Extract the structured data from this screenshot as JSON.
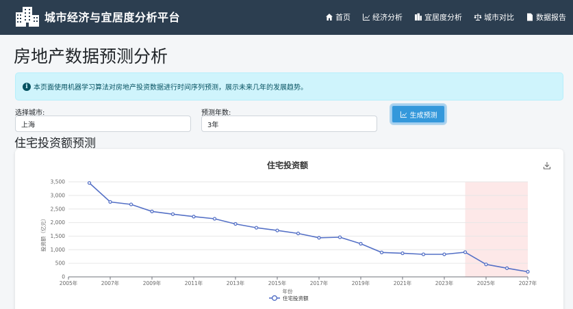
{
  "navbar": {
    "brand": "城市经济与宜居度分析平台",
    "items": [
      {
        "label": "首页",
        "icon": "home-icon"
      },
      {
        "label": "经济分析",
        "icon": "chart-line-icon"
      },
      {
        "label": "宜居度分析",
        "icon": "building-icon"
      },
      {
        "label": "城市对比",
        "icon": "balance-scale-icon"
      },
      {
        "label": "数据报告",
        "icon": "file-icon"
      }
    ]
  },
  "page": {
    "title": "房地产数据预测分析",
    "info": "本页面使用机器学习算法对房地产投资数据进行时间序列预测，展示未来几年的发展趋势。"
  },
  "form": {
    "city_label": "选择城市:",
    "city_value": "上海",
    "years_label": "预测年数:",
    "years_value": "3年",
    "button_label": "生成预测"
  },
  "section_title": "住宅投资额预测",
  "chart_data": {
    "type": "line",
    "title": "住宅投资额",
    "xlabel": "年份",
    "ylabel": "投资额（亿元）",
    "x_tick_labels": [
      "2005年",
      "2007年",
      "2009年",
      "2011年",
      "2013年",
      "2015年",
      "2017年",
      "2019年",
      "2021年",
      "2023年",
      "2025年",
      "2027年"
    ],
    "y_tick_labels": [
      "0",
      "500",
      "1,000",
      "1,500",
      "2,000",
      "2,500",
      "3,000",
      "3,500"
    ],
    "ylim": [
      0,
      3500
    ],
    "xlim": [
      2005,
      2027
    ],
    "forecast_range": [
      2024,
      2027
    ],
    "legend_position": "bottom-center",
    "series": [
      {
        "name": "住宅投资额",
        "color": "#5470c6",
        "x": [
          2006,
          2007,
          2008,
          2009,
          2010,
          2011,
          2012,
          2013,
          2014,
          2015,
          2016,
          2017,
          2018,
          2019,
          2020,
          2021,
          2022,
          2023,
          2024,
          2025,
          2026,
          2027
        ],
        "values": [
          3460,
          2760,
          2670,
          2410,
          2310,
          2220,
          2140,
          1950,
          1810,
          1710,
          1600,
          1440,
          1460,
          1220,
          900,
          870,
          830,
          830,
          910,
          460,
          320,
          190
        ]
      }
    ]
  },
  "colors": {
    "navbar": "#2c3e50",
    "accent": "#3498db",
    "series": "#5470c6",
    "forecast_band": "#fde8e8",
    "alert_bg": "#cff4fc"
  }
}
